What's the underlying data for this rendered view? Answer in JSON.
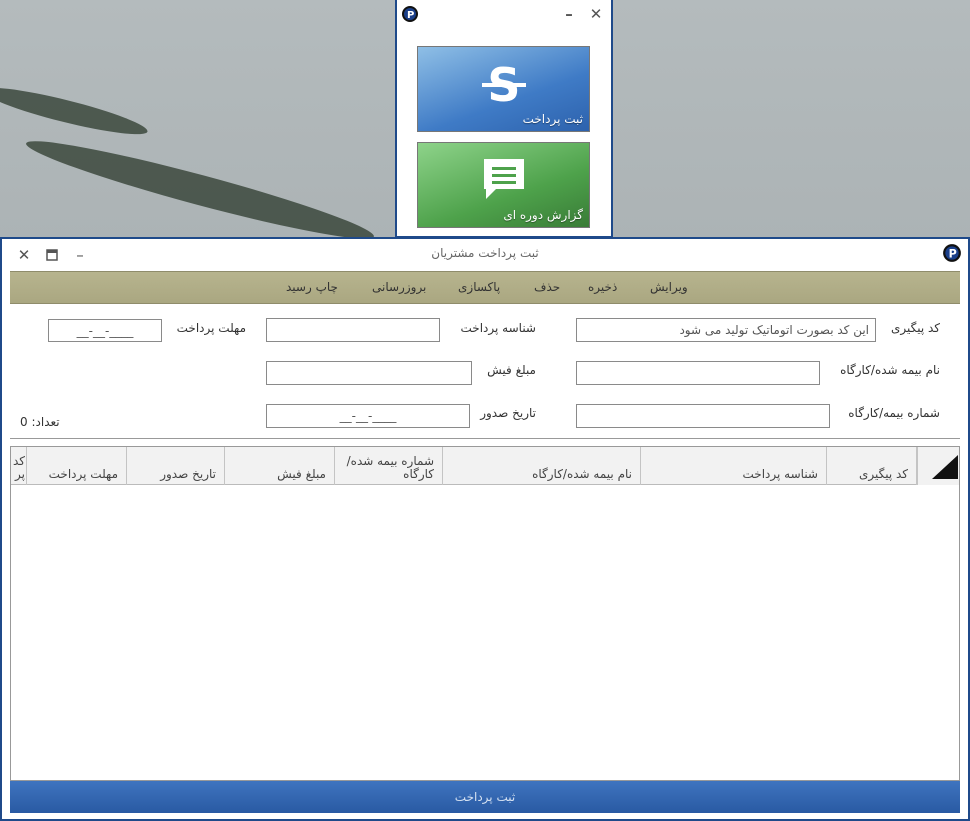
{
  "launcher": {
    "tiles": [
      {
        "label": "ثبت پرداخت",
        "icon": "currency-icon",
        "color": "#3f7bc6"
      },
      {
        "label": "گزارش دوره ای",
        "icon": "message-icon",
        "color": "#4ea24b"
      }
    ]
  },
  "window": {
    "title": "ثبت پرداخت مشتریان"
  },
  "menu": {
    "items": [
      "ویرایش",
      "ذخیره",
      "حذف",
      "پاکسازی",
      "بروزرسانی",
      "چاپ رسید"
    ]
  },
  "form": {
    "tracking_code_label": "کد پیگیری",
    "tracking_code_value": "این کد بصورت اتوماتیک تولید می شود",
    "payment_id_label": "شناسه پرداخت",
    "payment_id_value": "",
    "due_date_label": "مهلت پرداخت",
    "due_date_mask": "__-__-____",
    "insured_name_label": "نام بیمه شده/کارگاه",
    "insured_name_value": "",
    "receipt_amount_label": "مبلغ فیش",
    "receipt_amount_value": "",
    "insured_number_label": "شماره بیمه/کارگاه",
    "insured_number_value": "",
    "issue_date_label": "تاریخ صدور",
    "issue_date_mask": "__-__-____",
    "count_label": ":تعداد",
    "count_value": "0"
  },
  "grid": {
    "columns": [
      "کد پیگیری",
      "شناسه پرداخت",
      "نام بیمه شده/کارگاه",
      "شماره بیمه شده/کارگاه",
      "مبلغ فیش",
      "تاریخ صدور",
      "مهلت پرداخت",
      "کد پر"
    ],
    "rows": []
  },
  "submit_label": "ثبت پرداخت",
  "colors": {
    "window_border": "#1f4a8a",
    "menubar": "#b0ad87",
    "bottombar": "#3a6cb6",
    "app_icon": "#1a3f8a"
  }
}
